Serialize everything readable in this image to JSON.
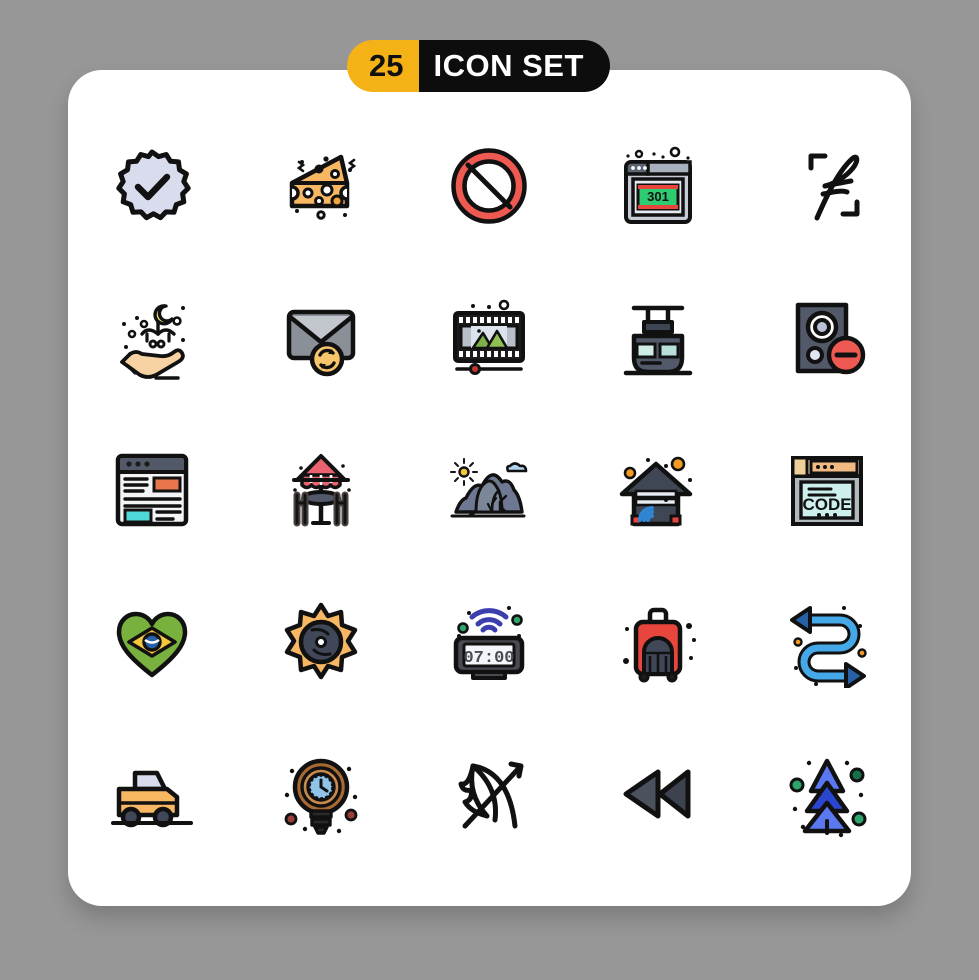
{
  "background_color": "#979797",
  "card_color": "#ffffff",
  "header": {
    "count": "25",
    "title": "ICON SET",
    "count_bg": "#F5B216",
    "title_bg": "#0D0D0D",
    "count_text_color": "#111111",
    "title_text_color": "#FFFFFF"
  },
  "palette": {
    "stroke": "#111111",
    "lavender": "#D9DCEC",
    "orange": "#F7B763",
    "red": "#EE5A52",
    "green": "#22B25A",
    "cyan": "#4FD8D8",
    "slate": "#525968",
    "blue": "#4A90E2",
    "light_blue": "#45A8E8",
    "tan": "#F3CE9A",
    "leaf_green": "#7EB048"
  },
  "grid": {
    "rows": 5,
    "columns": 5,
    "total_icons": 25
  },
  "icons": [
    {
      "row": 1,
      "col": 1,
      "name": "verified-badge-icon",
      "label": "Verified badge with check mark"
    },
    {
      "row": 1,
      "col": 2,
      "name": "cheese-icon",
      "label": "Cheese wedge"
    },
    {
      "row": 1,
      "col": 3,
      "name": "prohibition-icon",
      "label": "Prohibition / ban sign"
    },
    {
      "row": 1,
      "col": 4,
      "name": "browser-301-icon",
      "label": "Browser window 301 redirect",
      "text": "301"
    },
    {
      "row": 1,
      "col": 5,
      "name": "signature-icon",
      "label": "Handwritten signature in brackets"
    },
    {
      "row": 2,
      "col": 1,
      "name": "eid-hand-icon",
      "label": "Hand holding crescent moon calligraphy"
    },
    {
      "row": 2,
      "col": 2,
      "name": "email-sync-icon",
      "label": "Envelope with sync badge"
    },
    {
      "row": 2,
      "col": 3,
      "name": "video-photo-icon",
      "label": "Film strip with photo and slider"
    },
    {
      "row": 2,
      "col": 4,
      "name": "cable-car-icon",
      "label": "Cable car tram"
    },
    {
      "row": 2,
      "col": 5,
      "name": "speaker-minus-icon",
      "label": "Speaker with minus badge"
    },
    {
      "row": 3,
      "col": 1,
      "name": "web-layout-icon",
      "label": "Web page layout"
    },
    {
      "row": 3,
      "col": 2,
      "name": "patio-table-icon",
      "label": "Patio table with umbrella"
    },
    {
      "row": 3,
      "col": 3,
      "name": "mountain-landscape-icon",
      "label": "Mountain landscape with sun"
    },
    {
      "row": 3,
      "col": 4,
      "name": "smart-garage-icon",
      "label": "Smart garage with wifi"
    },
    {
      "row": 3,
      "col": 5,
      "name": "browser-code-icon",
      "label": "Browser window with code",
      "text": "CODE"
    },
    {
      "row": 4,
      "col": 1,
      "name": "brazil-heart-icon",
      "label": "Brazil flag heart"
    },
    {
      "row": 4,
      "col": 2,
      "name": "sun-disc-icon",
      "label": "Sun gear with disc"
    },
    {
      "row": 4,
      "col": 3,
      "name": "smart-alarm-clock-icon",
      "label": "Digital alarm clock with wifi",
      "text": "07:00"
    },
    {
      "row": 4,
      "col": 4,
      "name": "luggage-icon",
      "label": "Rolling suitcase"
    },
    {
      "row": 4,
      "col": 5,
      "name": "zigzag-arrows-icon",
      "label": "S curve double arrow path"
    },
    {
      "row": 5,
      "col": 1,
      "name": "car-icon",
      "label": "Car / pickup truck"
    },
    {
      "row": 5,
      "col": 2,
      "name": "idea-time-icon",
      "label": "Light bulb with clock"
    },
    {
      "row": 5,
      "col": 3,
      "name": "bow-arrow-icon",
      "label": "Bow and arrow archery"
    },
    {
      "row": 5,
      "col": 4,
      "name": "rewind-icon",
      "label": "Rewind media control"
    },
    {
      "row": 5,
      "col": 5,
      "name": "christmas-tree-icon",
      "label": "Christmas tree"
    }
  ]
}
